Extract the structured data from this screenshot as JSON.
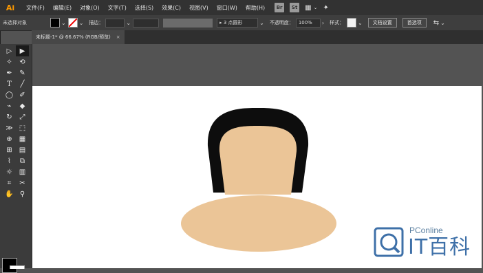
{
  "app": {
    "logo": "Ai"
  },
  "menu": [
    "文件(F)",
    "编辑(E)",
    "对象(O)",
    "文字(T)",
    "选择(S)",
    "效果(C)",
    "视图(V)",
    "窗口(W)",
    "帮助(H)"
  ],
  "menu_apps": [
    "Br",
    "St"
  ],
  "control": {
    "selection_status": "未选择对象",
    "stroke_label": "描边：",
    "brush_label": "3 点圆形",
    "opacity_label": "不透明度：",
    "opacity_value": "100%",
    "style_label": "样式：",
    "doc_setup_button": "文档设置",
    "preferences_button": "首选项"
  },
  "document": {
    "tab_title": "未标题-1* @ 66.67% (RGB/预览)",
    "close": "×"
  },
  "artwork": {
    "hair_color": "#0d0d0d",
    "skin_color": "#ebc597",
    "artboard_color": "#ffffff"
  },
  "watermark": {
    "brand": "PConline",
    "name": "IT百科"
  }
}
